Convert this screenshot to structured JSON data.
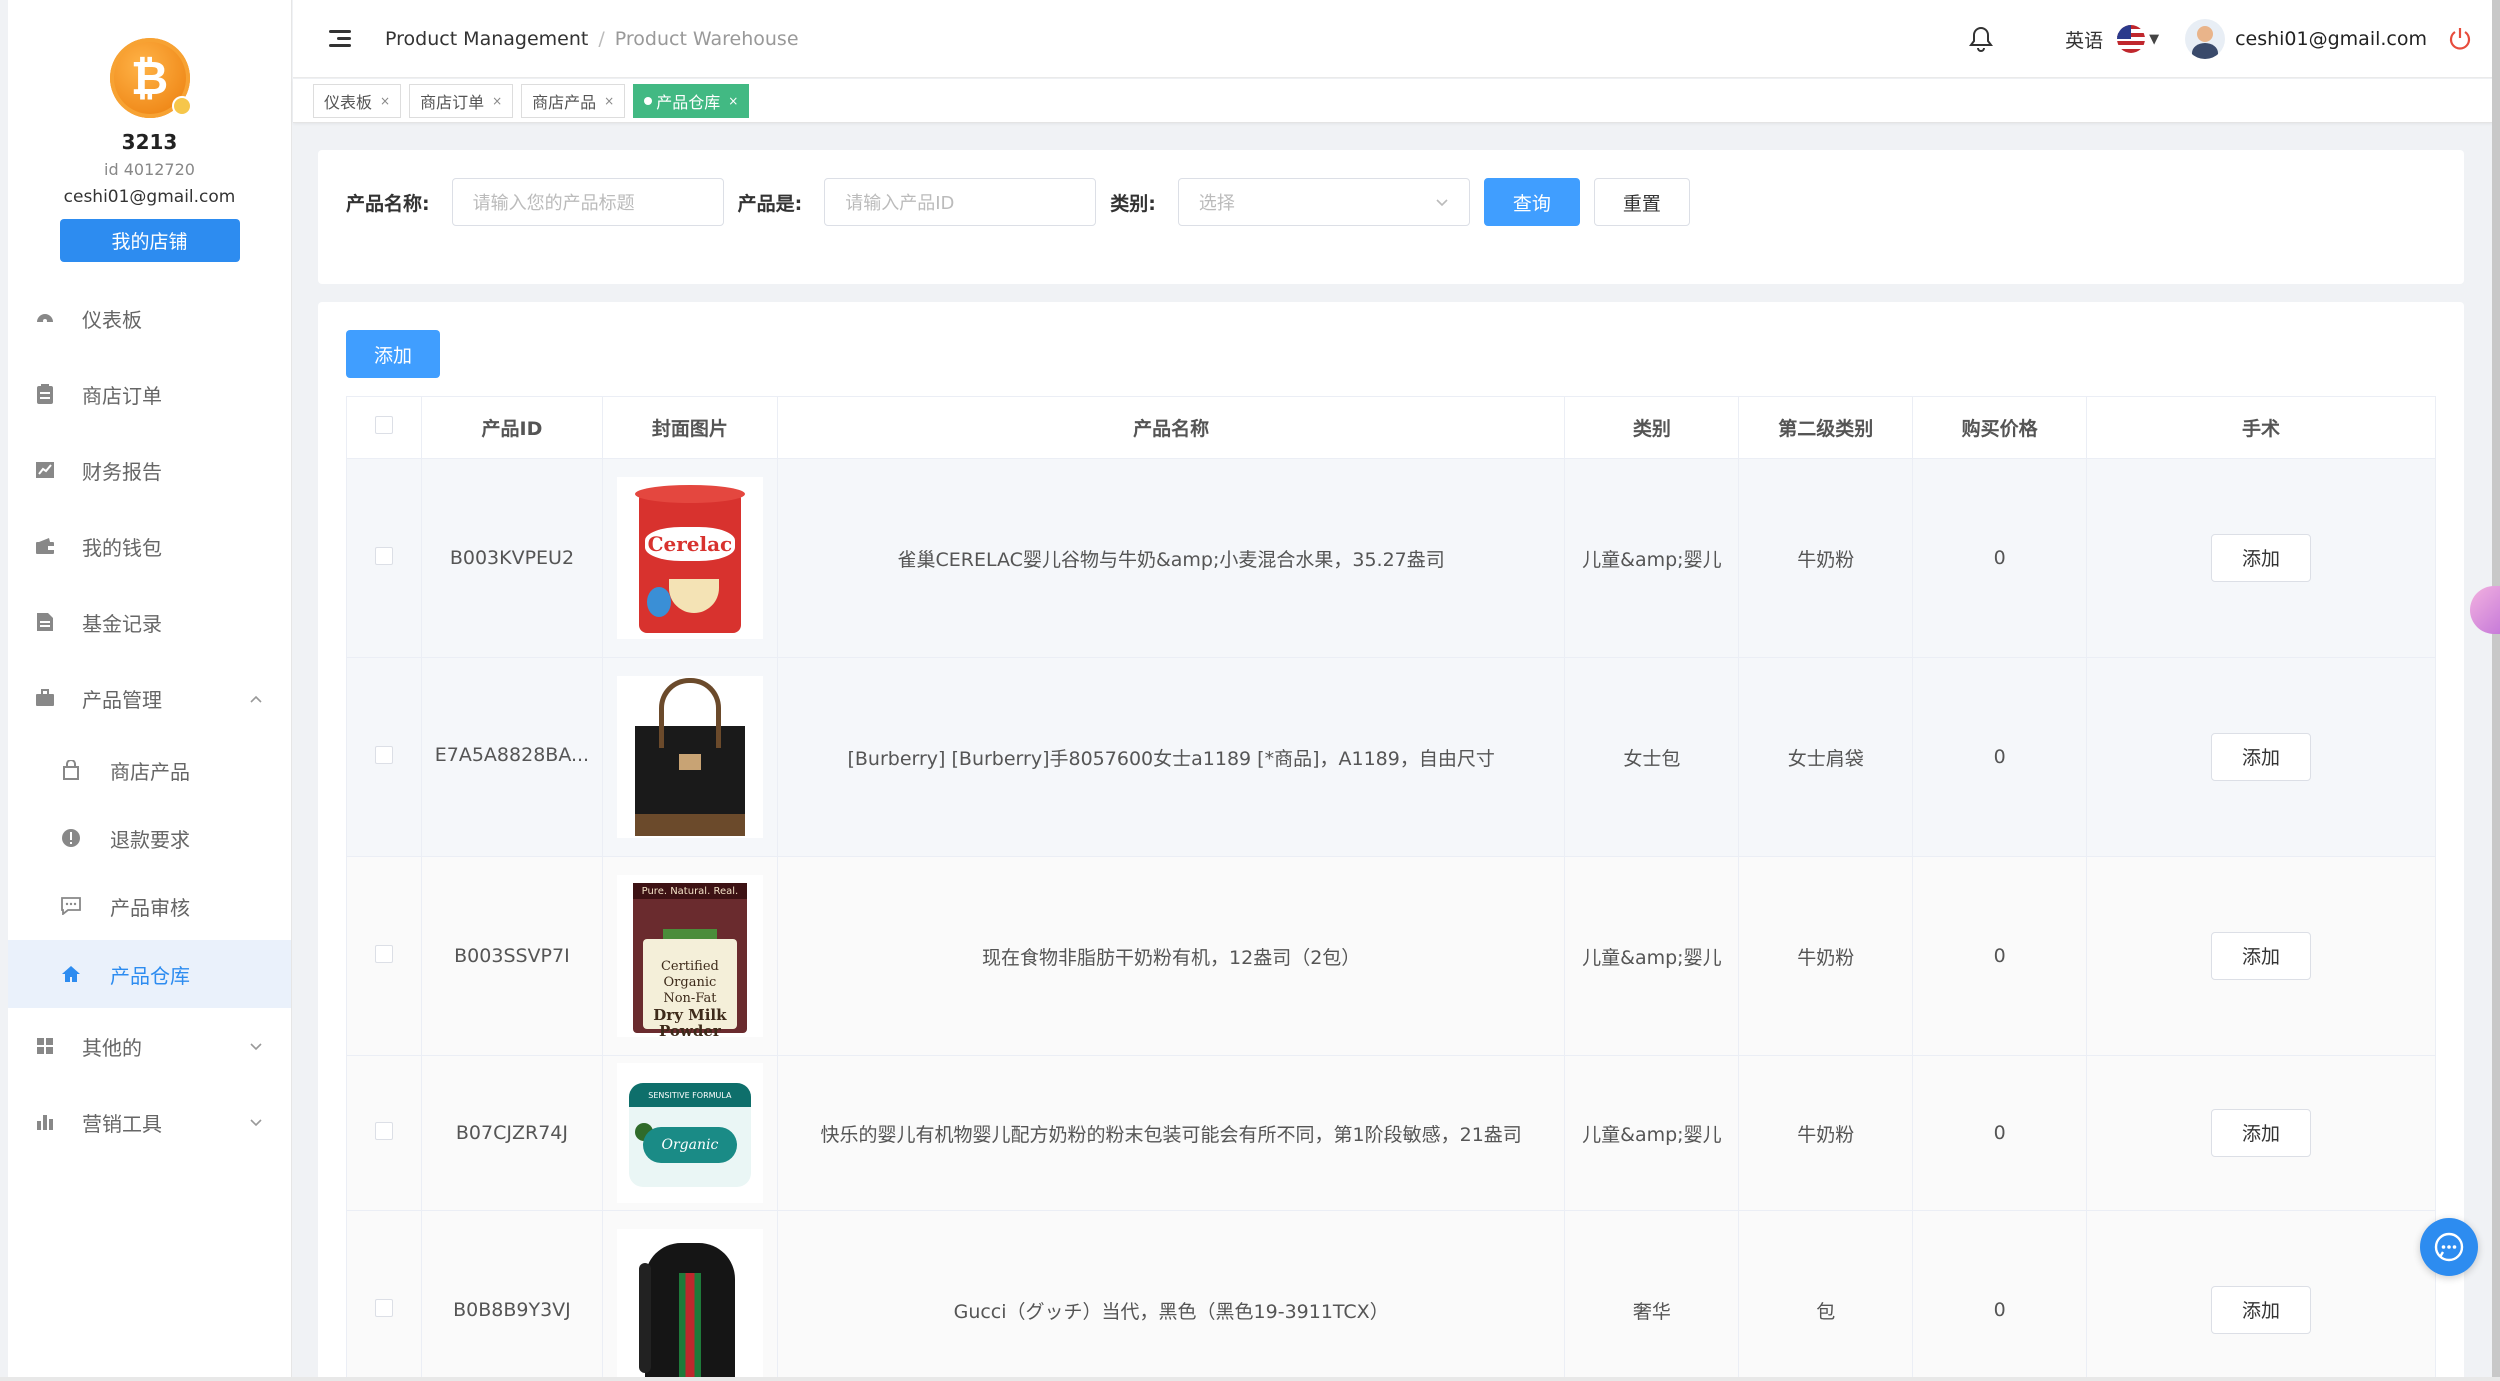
{
  "shop": {
    "name": "3213",
    "id_text": "id 4012720",
    "email": "ceshi01@gmail.com",
    "my_shop_label": "我的店铺"
  },
  "sidebar": {
    "items": [
      {
        "label": "仪表板",
        "icon": "dashboard-icon"
      },
      {
        "label": "商店订单",
        "icon": "clipboard-icon"
      },
      {
        "label": "财务报告",
        "icon": "chart-icon"
      },
      {
        "label": "我的钱包",
        "icon": "wallet-icon"
      },
      {
        "label": "基金记录",
        "icon": "document-icon"
      },
      {
        "label": "产品管理",
        "icon": "briefcase-icon",
        "expanded": true
      }
    ],
    "sub_items": [
      {
        "label": "商店产品",
        "icon": "bag-icon"
      },
      {
        "label": "退款要求",
        "icon": "alert-icon"
      },
      {
        "label": "产品审核",
        "icon": "message-icon"
      },
      {
        "label": "产品仓库",
        "icon": "home-icon",
        "active": true
      }
    ],
    "more_items": [
      {
        "label": "其他的",
        "icon": "grid-icon"
      },
      {
        "label": "营销工具",
        "icon": "bar-chart-icon"
      }
    ]
  },
  "header": {
    "breadcrumb_root": "Product Management",
    "breadcrumb_current": "Product Warehouse",
    "language": "英语",
    "user_email": "ceshi01@gmail.com"
  },
  "tabs": [
    {
      "label": "仪表板",
      "active": false
    },
    {
      "label": "商店订单",
      "active": false
    },
    {
      "label": "商店产品",
      "active": false
    },
    {
      "label": "产品仓库",
      "active": true
    }
  ],
  "search": {
    "name_label": "产品名称:",
    "name_placeholder": "请输入您的产品标题",
    "id_label": "产品是:",
    "id_placeholder": "请输入产品ID",
    "category_label": "类别:",
    "category_placeholder": "选择",
    "query_label": "查询",
    "reset_label": "重置"
  },
  "table": {
    "add_label": "添加",
    "columns": [
      "产品ID",
      "封面图片",
      "产品名称",
      "类别",
      "第二级类别",
      "购买价格",
      "手术"
    ],
    "rows": [
      {
        "id": "B003KVPEU2",
        "image": "cerelac-can",
        "name": "雀巢CERELAC婴儿谷物与牛奶&amp;小麦混合水果，35.27盎司",
        "category": "儿童&amp;婴儿",
        "subcategory": "牛奶粉",
        "price": "0",
        "action": "添加"
      },
      {
        "id": "E7A5A8828BA...",
        "image": "burberry-bag",
        "name": "[Burberry] [Burberry]手8057600女士a1189 [*商品]，A1189，自由尺寸",
        "category": "女士包",
        "subcategory": "女士肩袋",
        "price": "0",
        "action": "添加"
      },
      {
        "id": "B003SSVP7I",
        "image": "dry-milk-pouch",
        "name": "现在食物非脂肪干奶粉有机，12盎司（2包）",
        "category": "儿童&amp;婴儿",
        "subcategory": "牛奶粉",
        "price": "0",
        "action": "添加"
      },
      {
        "id": "B07CJZR74J",
        "image": "formula-tub",
        "name": "快乐的婴儿有机物婴儿配方奶粉的粉末包装可能会有所不同，第1阶段敏感，21盎司",
        "category": "儿童&amp;婴儿",
        "subcategory": "牛奶粉",
        "price": "0",
        "action": "添加"
      },
      {
        "id": "B0B8B9Y3VJ",
        "image": "gucci-backpack",
        "name": "Gucci（グッチ）当代，黑色（黑色19-3911TCX）",
        "category": "奢华",
        "subcategory": "包",
        "price": "0",
        "action": "添加"
      }
    ]
  },
  "image_text": {
    "cerelac": "Cerelac",
    "pouch_top": "Pure. Natural. Real.",
    "pouch_l1": "Certified Organic",
    "pouch_l2": "Non-Fat",
    "pouch_l3": "Dry Milk",
    "pouch_l4": "Powder",
    "tub_top": "SENSITIVE FORMULA",
    "tub_brand": "Organic"
  },
  "colors": {
    "primary": "#409eff",
    "active_tab": "#42b983",
    "price": "#409eff"
  }
}
